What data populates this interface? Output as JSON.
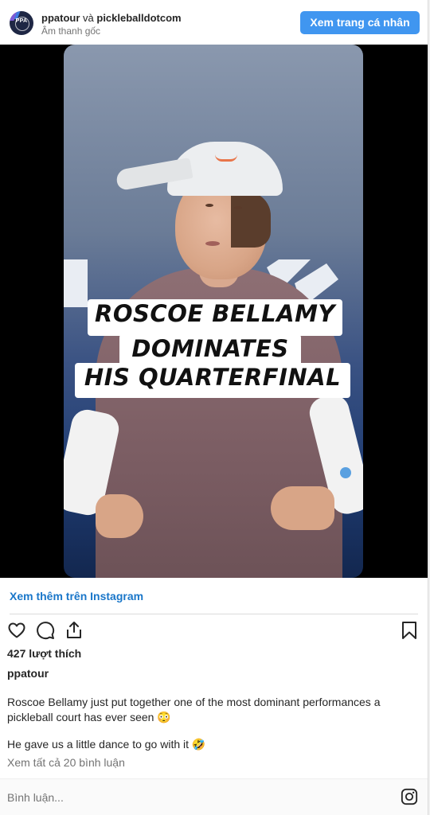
{
  "header": {
    "account1": "ppatour",
    "joiner": "và",
    "account2": "pickleballdotcom",
    "audio": "Âm thanh gốc",
    "view_profile_label": "Xem trang cá nhân",
    "avatar_text": "PPA"
  },
  "video": {
    "overlay_lines": [
      "ROSCOE BELLAMY",
      "DOMINATES",
      "HIS QUARTERFINAL"
    ]
  },
  "post": {
    "more_link": "Xem thêm trên Instagram",
    "likes": "427 lượt thích",
    "owner": "ppatour",
    "caption_line1": "Roscoe Bellamy just put together one of the most dominant performances a pickleball court has ever seen 😳",
    "caption_line2": "He gave us a little dance to go with it 🤣",
    "view_comments": "Xem tất cả 20 bình luận"
  },
  "comment": {
    "placeholder": "Bình luận..."
  },
  "colors": {
    "accent": "#4096f0",
    "link": "#1976c9"
  },
  "icons": [
    "heart-icon",
    "comment-icon",
    "share-icon",
    "bookmark-icon",
    "instagram-icon"
  ]
}
